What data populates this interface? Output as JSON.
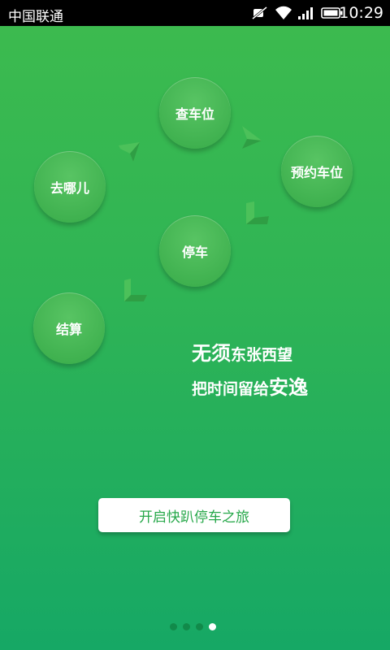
{
  "status_bar": {
    "carrier": "中国联通",
    "time": "10:29",
    "icons": [
      "mute-icon",
      "wifi-icon",
      "signal-icon",
      "battery-icon"
    ]
  },
  "flow": {
    "steps": [
      "去哪儿",
      "查车位",
      "预约车位",
      "停车",
      "结算"
    ]
  },
  "slogan": {
    "line1_big": "无须",
    "line1_small": "东张西望",
    "line2_small": "把时间留给",
    "line2_big": "安逸"
  },
  "start_button_label": "开启快趴停车之旅",
  "pager": {
    "total": 4,
    "current": 4
  },
  "colors": {
    "bg_top": "#3dbb4e",
    "bg_bottom": "#16a865",
    "button_text": "#27a84a"
  }
}
